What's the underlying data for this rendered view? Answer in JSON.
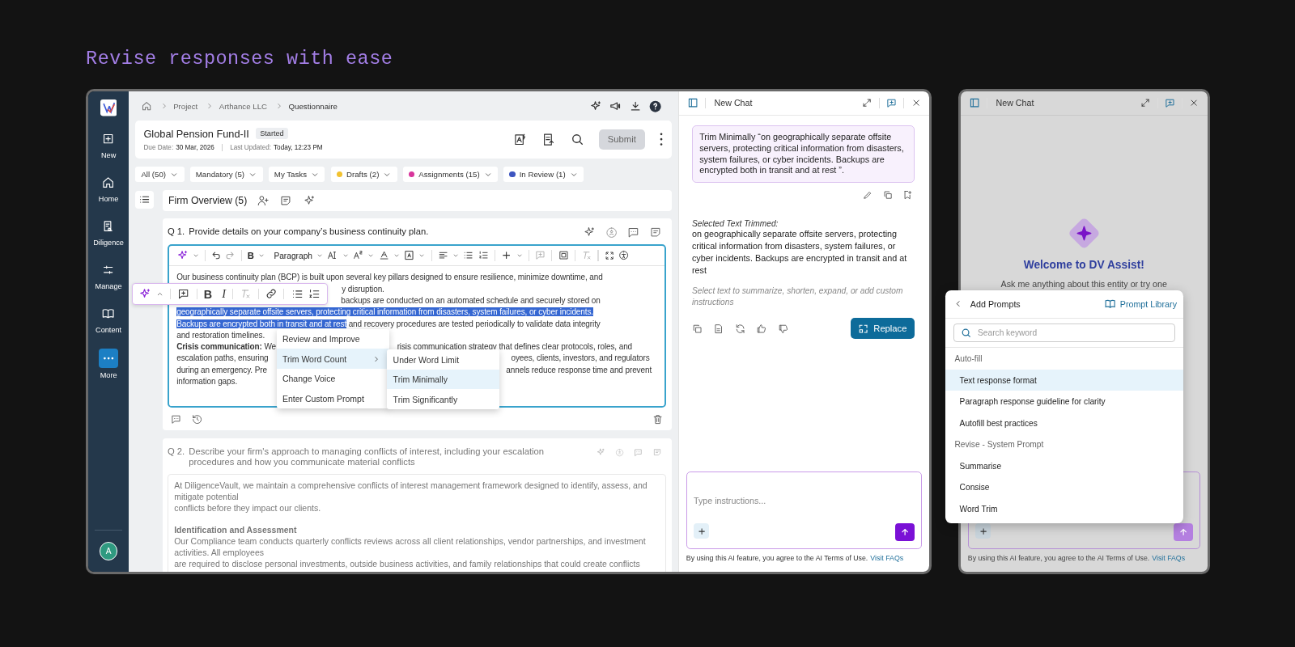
{
  "headline": "Revise responses with ease",
  "app": {
    "sidebar": {
      "items": [
        {
          "label": "New",
          "selected": false
        },
        {
          "label": "Home",
          "selected": false
        },
        {
          "label": "Diligence",
          "selected": false
        },
        {
          "label": "Manage",
          "selected": false
        },
        {
          "label": "Content",
          "selected": false
        },
        {
          "label": "More",
          "selected": true
        }
      ],
      "avatar": "A"
    },
    "breadcrumb": [
      "Project",
      "Arthance LLC",
      "Questionnaire"
    ],
    "header": {
      "title": "Global Pension Fund-II",
      "status": "Started",
      "due_label": "Due Date:",
      "due": "30 Mar, 2026",
      "updated_label": "Last Updated:",
      "updated": "Today, 12:23 PM",
      "submit": "Submit"
    },
    "filters": [
      {
        "label": "All (50)"
      },
      {
        "label": "Mandatory (5)"
      },
      {
        "label": "My Tasks"
      },
      {
        "label": "Drafts (2)",
        "color": "#f2c230"
      },
      {
        "label": "Assignments (15)",
        "color": "#d8369c"
      },
      {
        "label": "In Review (1)",
        "color": "#3d55c0"
      }
    ],
    "section": {
      "title": "Firm Overview (5)"
    },
    "questions": [
      {
        "kind": "editor",
        "number": "Q 1.",
        "text": "Provide details on your company’s business continuity plan.",
        "disabled": false,
        "toolbar": {
          "bold": "B",
          "block_style": "Paragraph"
        },
        "lines": [
          {
            "segments": [
              {
                "text": "Our business continuity plan (BCP) is built upon several key pillars designed to ensure resilience, minimize downtime, and",
                "selected": false
              }
            ]
          },
          {
            "segments": [
              {
                "text": "y disruption.",
                "selected": false
              }
            ]
          },
          {
            "segments": [
              {
                "text": "backups are conducted on an automated schedule and securely stored on",
                "selected": false
              }
            ]
          },
          {
            "segments": [
              {
                "text": " geographically separate offsite servers, protecting critical information from disasters, system failures, or cyber incidents.",
                "selected": true
              }
            ]
          },
          {
            "segments": [
              {
                "text": "Backups are encrypted both in transit and at rest",
                "selected": true
              },
              {
                "text": " and recovery procedures are tested periodically to validate data integrity",
                "selected": false
              }
            ]
          },
          {
            "segments": [
              {
                "text": "and restoration timelines.",
                "selected": false
              }
            ]
          },
          {
            "segments": [
              {
                "text": "**Crisis communication:** We",
                "selected": false
              },
              {
                "text": "risis communication strategy that defines clear protocols, roles, and",
                "selected": false
              }
            ]
          },
          {
            "segments": [
              {
                "text": "escalation paths, ensuring",
                "selected": false
              },
              {
                "text": "oyees, clients, investors, and regulators",
                "selected": false
              }
            ]
          },
          {
            "segments": [
              {
                "text": "during an emergency. Pre",
                "selected": false
              },
              {
                "text": "annels reduce response time and prevent",
                "selected": false
              }
            ]
          },
          {
            "segments": [
              {
                "text": "information gaps.",
                "selected": false
              }
            ]
          }
        ],
        "float_toolbar": {
          "bold": "B",
          "italic": "I"
        },
        "menu": [
          {
            "label": "Review and Improve",
            "selected": false,
            "submenu": false
          },
          {
            "label": "Trim Word Count",
            "selected": true,
            "submenu": true
          },
          {
            "label": "Change Voice",
            "selected": false,
            "submenu": false
          },
          {
            "label": "Enter Custom Prompt",
            "selected": false,
            "submenu": false
          }
        ],
        "submenu": [
          {
            "label": "Under Word Limit",
            "selected": false
          },
          {
            "label": "Trim Minimally",
            "selected": true
          },
          {
            "label": "Trim Significantly",
            "selected": false
          }
        ]
      },
      {
        "kind": "answer",
        "number": "Q 2.",
        "text": "Describe your firm's approach to managing conflicts of interest, including your escalation procedures and how you communicate material conflicts",
        "disabled": true,
        "paragraphs": [
          "At DiligenceVault, we maintain a comprehensive conflicts of interest management framework designed to identify, assess, and\nmitigate potential\nconflicts before they impact our clients.",
          "**Identification and Assessment**\nOur Compliance team conducts quarterly conflicts reviews across all client  relationships, vendor partnerships, and investment activities. All employees\nare required to disclose personal investments, outside business activities,  and family relationships that could create conflicts"
        ]
      }
    ],
    "chat": {
      "title": "New Chat",
      "user_message": "Trim Minimally “on geographically separate offsite servers, protecting critical information from disasters, system failures, or cyber incidents. Backups are encrypted both in transit and at rest ”.",
      "result_label": "Selected Text Trimmed:",
      "result": "on geographically separate offsite servers, protecting critical information from disasters, system failures, or cyber incidents. Backups are encrypted in transit and at rest",
      "hint": "Select text to summarize, shorten, expand, or add custom instructions",
      "replace": "Replace",
      "input_placeholder": "Type instructions...",
      "footer": "By using this AI feature, you agree to the AI Terms of Use.",
      "footer_link": "Visit FAQs"
    }
  },
  "assist": {
    "title": "New Chat",
    "welcome": "Welcome to DV Assist!",
    "intro": "Ask me anything about this entity or try one",
    "prompts": {
      "title": "Add Prompts",
      "library": "Prompt Library",
      "search_placeholder": "Search keyword",
      "groups": [
        {
          "label": "Auto-fill",
          "items": [
            {
              "label": "Text response format",
              "selected": true
            },
            {
              "label": "Paragraph response guideline for clarity",
              "selected": false
            },
            {
              "label": "Autofill best practices",
              "selected": false
            }
          ]
        },
        {
          "label": "Revise - System Prompt",
          "items": [
            {
              "label": "Summarise",
              "selected": false
            },
            {
              "label": "Consise",
              "selected": false
            },
            {
              "label": "Word Trim",
              "selected": false
            }
          ]
        }
      ]
    },
    "footer": "By using this AI feature, you agree to the AI Terms of Use.",
    "footer_link": "Visit FAQs"
  }
}
